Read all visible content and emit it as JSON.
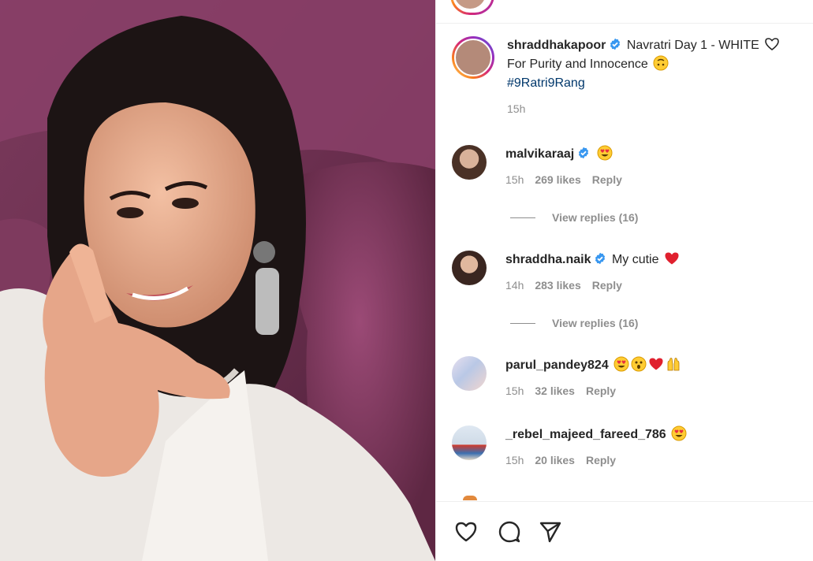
{
  "post": {
    "username": "shraddhakapoor",
    "caption": "Navratri Day 1 - WHITE",
    "caption_line2": "For Purity and Innocence",
    "hashtag": "#9Ratri9Rang",
    "time": "15h"
  },
  "comments": [
    {
      "username": "malvikaraaj",
      "verified": true,
      "text": "",
      "emojis": [
        "heart-eyes"
      ],
      "time": "15h",
      "likes": "269 likes",
      "reply": "Reply",
      "view_replies": "View replies (16)"
    },
    {
      "username": "shraddha.naik",
      "verified": true,
      "text": "My cutie",
      "emojis": [
        "red-heart"
      ],
      "time": "14h",
      "likes": "283 likes",
      "reply": "Reply",
      "view_replies": "View replies (16)"
    },
    {
      "username": "parul_pandey824",
      "verified": false,
      "text": "",
      "emojis": [
        "heart-eyes",
        "astonished",
        "red-heart",
        "raised-hands"
      ],
      "time": "15h",
      "likes": "32 likes",
      "reply": "Reply"
    },
    {
      "username": "_rebel_majeed_fareed_786",
      "verified": false,
      "text": "",
      "emojis": [
        "heart-eyes"
      ],
      "time": "15h",
      "likes": "20 likes",
      "reply": "Reply"
    }
  ],
  "actions": {
    "like_icon": "heart-outline-icon",
    "comment_icon": "comment-bubble-icon",
    "share_icon": "paper-plane-icon"
  },
  "colors": {
    "verified": "#3897f0",
    "hashtag": "#00376b",
    "meta": "#8e8e8e",
    "heart": "#ed4956"
  }
}
